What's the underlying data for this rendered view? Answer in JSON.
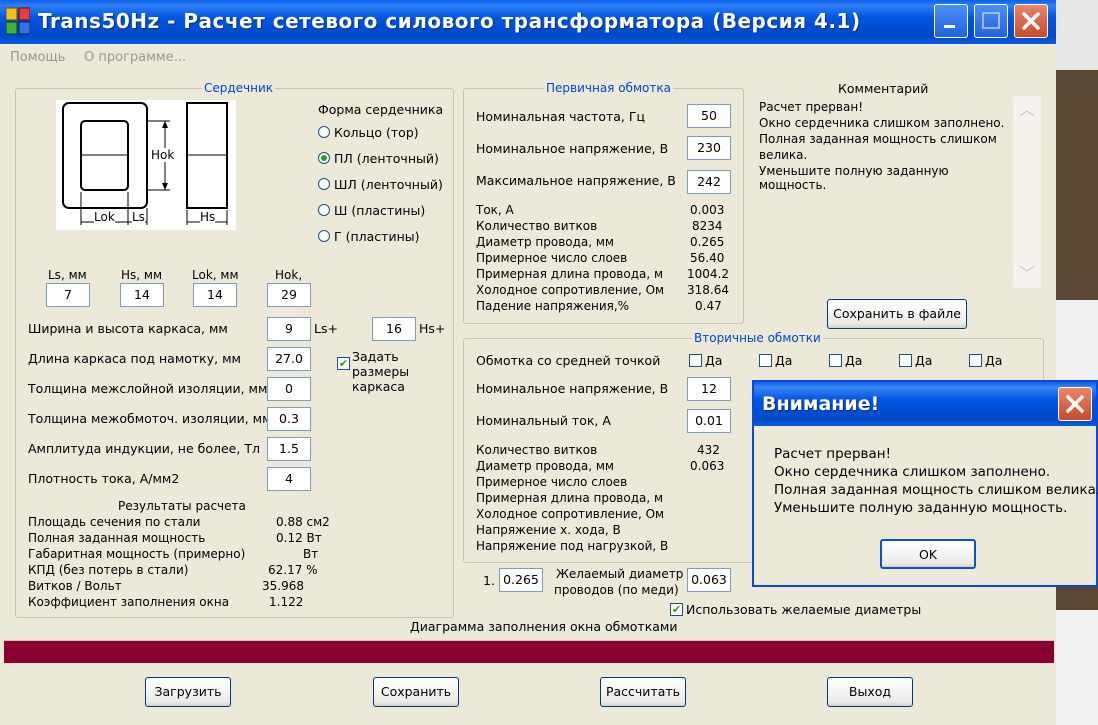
{
  "window": {
    "title": "Trans50Hz - Расчет сетевого силового трансформатора (Версия 4.1)",
    "app_icon": "transformer-app-icon"
  },
  "menu": [
    "Помощь",
    "О программе..."
  ],
  "core": {
    "group_title": "Сердечник",
    "diagram_labels": {
      "hok": "Hok",
      "lok": "Lok",
      "ls": "Ls",
      "hs": "Hs"
    },
    "shape_title": "Форма сердечника",
    "shapes": [
      {
        "label": "Кольцо  (тор)",
        "selected": false
      },
      {
        "label": "ПЛ  (ленточный)",
        "selected": true
      },
      {
        "label": "ШЛ  (ленточный)",
        "selected": false
      },
      {
        "label": "Ш  (пластины)",
        "selected": false
      },
      {
        "label": "Г  (пластины)",
        "selected": false
      }
    ],
    "dims": [
      {
        "label": "Ls, мм",
        "value": "7"
      },
      {
        "label": "Hs, мм",
        "value": "14"
      },
      {
        "label": "Lok, мм",
        "value": "14"
      },
      {
        "label": "Hok,",
        "value": "29"
      }
    ],
    "frame_size_label": "Ширина и высота каркаса, мм",
    "frame_w": "9",
    "frame_w_suffix": "Ls+",
    "frame_h": "16",
    "frame_h_suffix": "Hs+",
    "wind_len_label": "Длина каркаса под намотку, мм",
    "wind_len": "27.0",
    "set_frame_label": "Задать размеры каркаса",
    "set_frame_checked": true,
    "interlayer_label": "Толщина межслойной изоляции, мм",
    "interlayer": "0",
    "interwinding_label": "Толщина межобмоточ. изоляции, мм",
    "interwinding": "0.3",
    "induction_label": "Амплитуда индукции, не более, Тл",
    "induction": "1.5",
    "current_density_label": "Плотность тока, А/мм2",
    "current_density": "4"
  },
  "results": {
    "title": "Результаты расчета",
    "rows": [
      {
        "label": "Площадь сечения по стали",
        "value": "0.88 см2"
      },
      {
        "label": "Полная заданная мощность",
        "value": "0.12 Вт"
      },
      {
        "label": "Габаритная мощность (примерно)",
        "value": "Вт"
      },
      {
        "label": "КПД (без потерь в стали)",
        "value": "62.17 %"
      },
      {
        "label": "Витков / Вольт",
        "value": "35.968"
      },
      {
        "label": "Коэффициент заполнения окна",
        "value": "1.122"
      }
    ]
  },
  "primary": {
    "group_title": "Первичная обмотка",
    "freq_label": "Номинальная частота, Гц",
    "freq": "50",
    "nom_v_label": "Номинальное напряжение, В",
    "nom_v": "230",
    "max_v_label": "Максимальное напряжение, В",
    "max_v": "242",
    "rows": [
      {
        "label": "Ток, А",
        "value": "0.003"
      },
      {
        "label": "Количество витков",
        "value": "8234"
      },
      {
        "label": "Диаметр провода, мм",
        "value": "0.265"
      },
      {
        "label": "Примерное число слоев",
        "value": "56.40"
      },
      {
        "label": "Примерная длина провода, м",
        "value": "1004.2"
      },
      {
        "label": "Холодное сопротивление, Ом",
        "value": "318.64"
      },
      {
        "label": "Падение напряжения,%",
        "value": "0.47"
      }
    ]
  },
  "comment": {
    "title": "Комментарий",
    "lines": [
      "Расчет прерван!",
      "Окно сердечника слишком заполнено.",
      "Полная заданная мощность слишком",
      "велика.",
      "Уменьшите полную заданную мощность."
    ],
    "save_button": "Сохранить в файле"
  },
  "secondary": {
    "group_title": "Вторичные обмотки",
    "center_tap_label": "Обмотка со средней точкой",
    "yes_label": "Да",
    "nom_v_label": "Номинальное напряжение, В",
    "nom_v": "12",
    "nom_i_label": "Номинальный ток, А",
    "nom_i": "0.01",
    "rows": [
      {
        "label": "Количество витков",
        "value": "432"
      },
      {
        "label": "Диаметр провода, мм",
        "value": "0.063"
      },
      {
        "label": "Примерное число слоев",
        "value": ""
      },
      {
        "label": "Примерная длина провода, м",
        "value": ""
      },
      {
        "label": "Холодное сопротивление, Ом",
        "value": ""
      },
      {
        "label": "Напряжение х. хода, В",
        "value": ""
      },
      {
        "label": "Напряжение под нагрузкой, В",
        "value": ""
      }
    ],
    "desired_index": "1.",
    "desired_primary": "0.265",
    "desired_label_1": "Желаемый диаметр",
    "desired_label_2": "проводов  (по меди)",
    "desired_secondary": "0.063",
    "use_desired_label": "Использовать желаемые диаметры",
    "use_desired_checked": true
  },
  "diagram": {
    "title": "Диаграмма заполнения окна обмотками",
    "fill_color": "#8a0030"
  },
  "buttons": {
    "load": "Загрузить",
    "save": "Сохранить",
    "calc": "Рассчитать",
    "exit": "Выход"
  },
  "dialog": {
    "title": "Внимание!",
    "lines": [
      "Расчет прерван!",
      "Окно сердечника слишком заполнено.",
      "Полная заданная мощность слишком велика.",
      "Уменьшите полную заданную мощность."
    ],
    "ok": "OK"
  }
}
